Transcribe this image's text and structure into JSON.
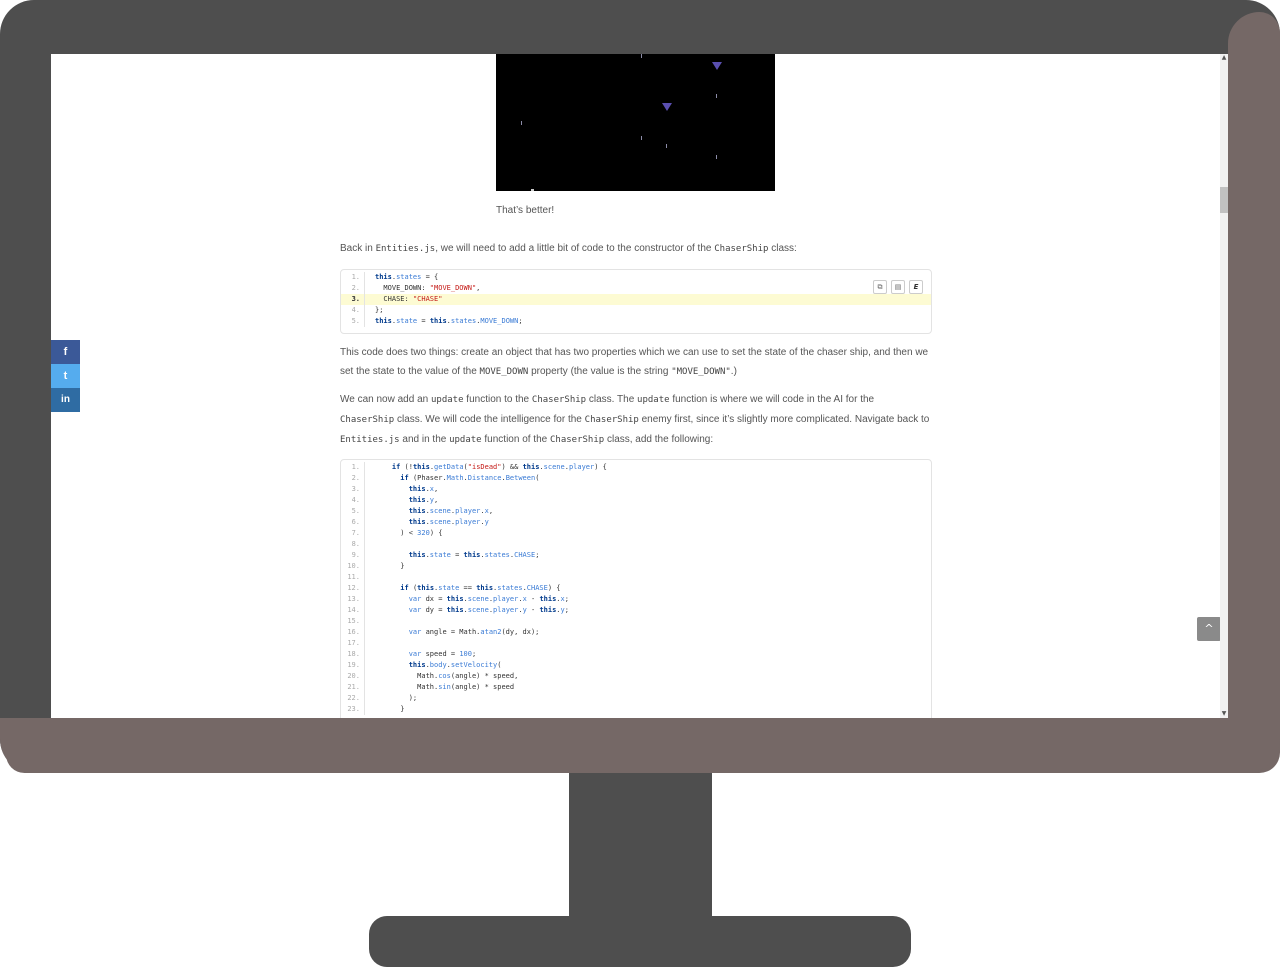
{
  "article": {
    "caption": "That’s better!",
    "para1": {
      "t1": "Back in ",
      "c1": "Entities.js",
      "t2": ", we will need to add a little bit of code to the constructor of the ",
      "c2": "ChaserShip",
      "t3": " class:"
    },
    "para2": {
      "t1": "This code does two things: create an object that has two properties which we can use to set the state of the chaser ship, and then we set the state to the value of the ",
      "c1": "MOVE_DOWN",
      "t2": " property (the value is the string ",
      "c2": "\"MOVE_DOWN\"",
      "t3": ".)"
    },
    "para3": {
      "t1": "We can now add an ",
      "c1": "update",
      "t2": " function to the ",
      "c2": "ChaserShip",
      "t3": " class. The ",
      "c3": "update",
      "t4": " function is where we will code in the AI for the ",
      "c4": "ChaserShip",
      "t5": " class. We will code the intelligence for the ",
      "c5": "ChaserShip",
      "t6": " enemy first, since it’s slightly more complicated. Navigate back to ",
      "c6": "Entities.js",
      "t7": " and in the ",
      "c7": "update",
      "t8": " function of the ",
      "c8": "ChaserShip",
      "t9": " class, add the following:"
    }
  },
  "code1": {
    "lines": [
      "1.",
      "2.",
      "3.",
      "4.",
      "5."
    ],
    "toolbar": {
      "copy_icon": "⧉",
      "view_icon": "▤",
      "edit_label": "E"
    }
  },
  "code2": {
    "lines": [
      "1.",
      "2.",
      "3.",
      "4.",
      "5.",
      "6.",
      "7.",
      "8.",
      "9.",
      "10.",
      "11.",
      "12.",
      "13.",
      "14.",
      "15.",
      "16.",
      "17.",
      "18.",
      "19.",
      "20.",
      "21.",
      "22.",
      "23."
    ]
  },
  "share": {
    "facebook": "f",
    "twitter": "t",
    "linkedin": "in"
  },
  "back_to_top": "^",
  "scroll_up": "▲",
  "scroll_down": "▼",
  "colors": {
    "monitor_dark": "#4e4e4e",
    "monitor_light": "#756866",
    "highlight": "#fdfbd3"
  }
}
